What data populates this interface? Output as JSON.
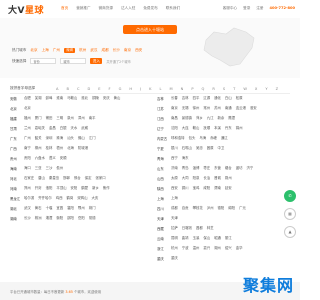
{
  "header": {
    "logo_main": "大V",
    "logo_accent": "星球",
    "nav_items": [
      "首页",
      "营销推广",
      "微商货源",
      "达人入驻",
      "免费发布",
      "联系我们"
    ],
    "top_right": {
      "service": "客服中心",
      "login": "登录",
      "register": "注册",
      "phone": "400-772-800"
    }
  },
  "hero": {
    "enter_button": "点击进入十堰站",
    "hot_label": "热门城市",
    "hot_cities": [
      "北京",
      "上海",
      "广州",
      "深圳",
      "杭州",
      "武汉",
      "成都",
      "长沙",
      "南京",
      "西安"
    ],
    "hot_selected": "深圳",
    "quick_label": "快速选择",
    "province_select": "省份",
    "city_select": "城市",
    "go_button": "进入",
    "quick_note": "共开通了2个城市"
  },
  "letters": {
    "label": "按拼音字母选择",
    "items": [
      "A",
      "B",
      "C",
      "D",
      "E",
      "F",
      "G",
      "H",
      "J",
      "K",
      "L",
      "M",
      "N",
      "P",
      "Q",
      "R",
      "S",
      "T",
      "W",
      "X",
      "Y",
      "Z"
    ]
  },
  "left_provinces": [
    {
      "name": "安徽",
      "cities": [
        "合肥",
        "芜湖",
        "蚌埠",
        "淮南",
        "马鞍山",
        "淮北",
        "铜陵",
        "安庆",
        "黄山"
      ]
    },
    {
      "name": "北京",
      "cities": [
        "北京"
      ]
    },
    {
      "name": "福建",
      "cities": [
        "福州",
        "厦门",
        "莆田",
        "三明",
        "泉州",
        "漳州",
        "南平"
      ]
    },
    {
      "name": "甘肃",
      "cities": [
        "兰州",
        "嘉峪关",
        "金昌",
        "白银",
        "天水",
        "武威"
      ]
    },
    {
      "name": "广东",
      "cities": [
        "广州",
        "韶关",
        "深圳",
        "珠海",
        "汕头",
        "佛山",
        "江门"
      ]
    },
    {
      "name": "广西",
      "cities": [
        "南宁",
        "柳州",
        "桂林",
        "梧州",
        "北海",
        "防城港"
      ]
    },
    {
      "name": "贵州",
      "cities": [
        "贵阳",
        "六盘水",
        "遵义",
        "安顺"
      ]
    },
    {
      "name": "海南",
      "cities": [
        "海口",
        "三亚",
        "三沙",
        "儋州"
      ]
    },
    {
      "name": "河北",
      "cities": [
        "石家庄",
        "唐山",
        "秦皇岛",
        "邯郸",
        "邢台",
        "保定",
        "张家口"
      ]
    },
    {
      "name": "河南",
      "cities": [
        "郑州",
        "开封",
        "洛阳",
        "平顶山",
        "安阳",
        "鹤壁",
        "新乡",
        "焦作"
      ]
    },
    {
      "name": "黑龙江",
      "cities": [
        "哈尔滨",
        "齐齐哈尔",
        "鸡西",
        "鹤岗",
        "双鸭山",
        "大庆"
      ]
    },
    {
      "name": "湖北",
      "cities": [
        "武汉",
        "黄石",
        "十堰",
        "宜昌",
        "襄阳",
        "鄂州",
        "荆门"
      ]
    },
    {
      "name": "湖南",
      "cities": [
        "长沙",
        "株洲",
        "湘潭",
        "衡阳",
        "邵阳",
        "岳阳",
        "常德"
      ]
    }
  ],
  "right_provinces": [
    {
      "name": "吉林",
      "cities": [
        "长春",
        "吉林",
        "四平",
        "辽源",
        "通化",
        "白山",
        "松原"
      ]
    },
    {
      "name": "江苏",
      "cities": [
        "南京",
        "无锡",
        "徐州",
        "常州",
        "苏州",
        "南通",
        "连云港",
        "淮安"
      ]
    },
    {
      "name": "江西",
      "cities": [
        "南昌",
        "景德镇",
        "萍乡",
        "九江",
        "新余",
        "鹰潭"
      ]
    },
    {
      "name": "辽宁",
      "cities": [
        "沈阳",
        "大连",
        "鞍山",
        "抚顺",
        "本溪",
        "丹东",
        "锦州"
      ]
    },
    {
      "name": "内蒙古",
      "cities": [
        "呼和浩特",
        "包头",
        "乌海",
        "赤峰",
        "通辽"
      ]
    },
    {
      "name": "宁夏",
      "cities": [
        "银川",
        "石嘴山",
        "吴忠",
        "固原",
        "中卫"
      ]
    },
    {
      "name": "青海",
      "cities": [
        "西宁",
        "海东"
      ]
    },
    {
      "name": "山东",
      "cities": [
        "济南",
        "青岛",
        "淄博",
        "枣庄",
        "东营",
        "烟台",
        "潍坊",
        "济宁"
      ]
    },
    {
      "name": "山西",
      "cities": [
        "太原",
        "大同",
        "阳泉",
        "长治",
        "晋城",
        "朔州"
      ]
    },
    {
      "name": "陕西",
      "cities": [
        "西安",
        "铜川",
        "宝鸡",
        "咸阳",
        "渭南",
        "延安"
      ]
    },
    {
      "name": "上海",
      "cities": [
        "上海"
      ]
    },
    {
      "name": "四川",
      "cities": [
        "成都",
        "自贡",
        "攀枝花",
        "泸州",
        "德阳",
        "绵阳",
        "广元"
      ]
    },
    {
      "name": "天津",
      "cities": [
        "天津"
      ]
    },
    {
      "name": "西藏",
      "cities": [
        "拉萨",
        "日喀则",
        "昌都",
        "林芝"
      ]
    },
    {
      "name": "云南",
      "cities": [
        "昆明",
        "曲靖",
        "玉溪",
        "保山",
        "昭通",
        "丽江"
      ]
    },
    {
      "name": "浙江",
      "cities": [
        "杭州",
        "宁波",
        "温州",
        "嘉兴",
        "湖州",
        "绍兴",
        "金华"
      ]
    },
    {
      "name": "重庆",
      "cities": [
        "重庆"
      ]
    }
  ],
  "footer": {
    "text_before": "平台已开通城市数量：每日不断更新",
    "count": "3.65",
    "text_after": "个城市，欢迎使用"
  },
  "watermark": "聚集网",
  "colors": {
    "accent": "#ff6a00",
    "watermark": "#0f7ddc"
  }
}
